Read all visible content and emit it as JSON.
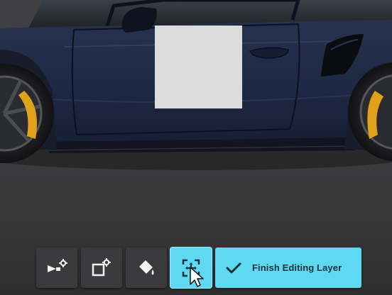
{
  "editor": {
    "mode": "layer-editing",
    "vehicle_color": "#1f2a45",
    "caliper_color": "#e0a21a",
    "layer_color": "#dcdcdc"
  },
  "toolbar": {
    "tools": [
      {
        "name": "spray-settings",
        "icon": "spray-gear-icon",
        "active": false
      },
      {
        "name": "layer-settings",
        "icon": "square-gear-icon",
        "active": false
      },
      {
        "name": "paint-fill",
        "icon": "paint-bucket-icon",
        "active": false
      },
      {
        "name": "transform",
        "icon": "move-arrows-icon",
        "active": true
      }
    ],
    "finish_label": "Finish Editing Layer",
    "finish_icon": "check-icon",
    "accent_color": "#5fd8f2"
  }
}
